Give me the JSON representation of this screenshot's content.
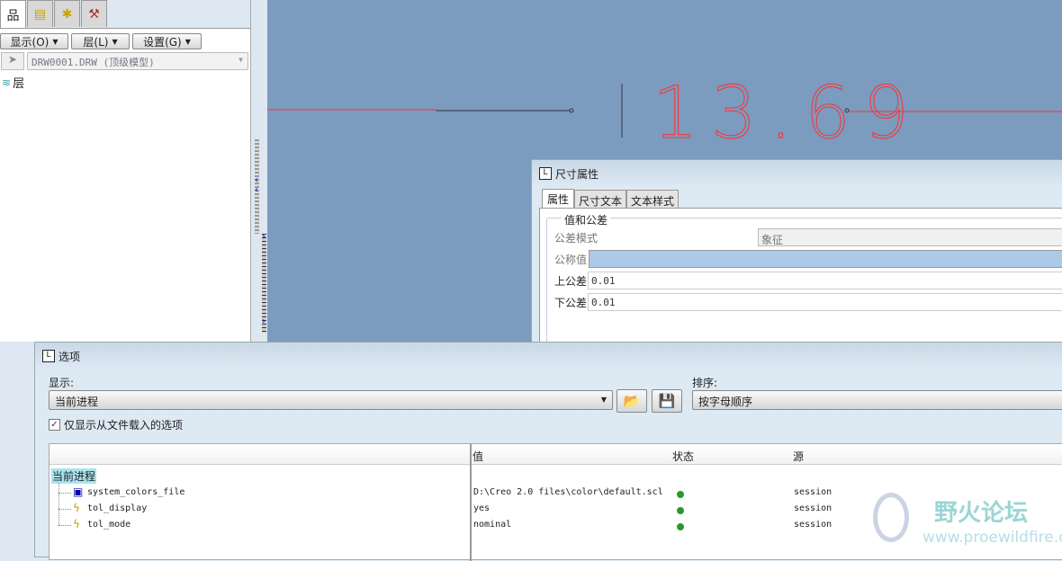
{
  "left_panel": {
    "tabs": [
      {
        "icon": "model-tree-icon"
      },
      {
        "icon": "folder-browser-icon"
      },
      {
        "icon": "favorites-icon"
      },
      {
        "icon": "tools-icon"
      }
    ],
    "menus": [
      {
        "label": "显示(O)"
      },
      {
        "label": "层(L)"
      },
      {
        "label": "设置(G)"
      }
    ],
    "model_select": "DRW0001.DRW (顶级模型)",
    "tree_item": "层"
  },
  "canvas": {
    "dimension_text": "13.69",
    "line_color": "#ff3030",
    "background": "#7b9bbf"
  },
  "dim_dialog": {
    "title": "尺寸属性",
    "tabs": [
      "属性",
      "尺寸文本",
      "文本样式"
    ],
    "group": "值和公差",
    "tol_mode_label": "公差模式",
    "tol_mode_value": "象征",
    "nominal_label": "公称值",
    "nominal_value": "",
    "upper_label": "上公差",
    "upper_value": "0.01",
    "lower_label": "下公差",
    "lower_value": "0.01"
  },
  "options_dialog": {
    "title": "选项",
    "show_label": "显示:",
    "show_value": "当前进程",
    "sort_label": "排序:",
    "sort_value": "按字母顺序",
    "checkbox_label": "仅显示从文件载入的选项",
    "checkbox_checked": true,
    "columns": [
      "",
      "值",
      "状态",
      "源"
    ],
    "root": "当前进程",
    "rows": [
      {
        "name": "system_colors_file",
        "value": "D:\\Creo 2.0 files\\color\\default.scl",
        "status": "green",
        "source": "session"
      },
      {
        "name": "tol_display",
        "value": "yes",
        "status": "green",
        "source": "session"
      },
      {
        "name": "tol_mode",
        "value": "nominal",
        "status": "green",
        "source": "session"
      }
    ]
  },
  "watermark": {
    "title": "野火论坛",
    "url": "www.proewildfire.cn"
  }
}
